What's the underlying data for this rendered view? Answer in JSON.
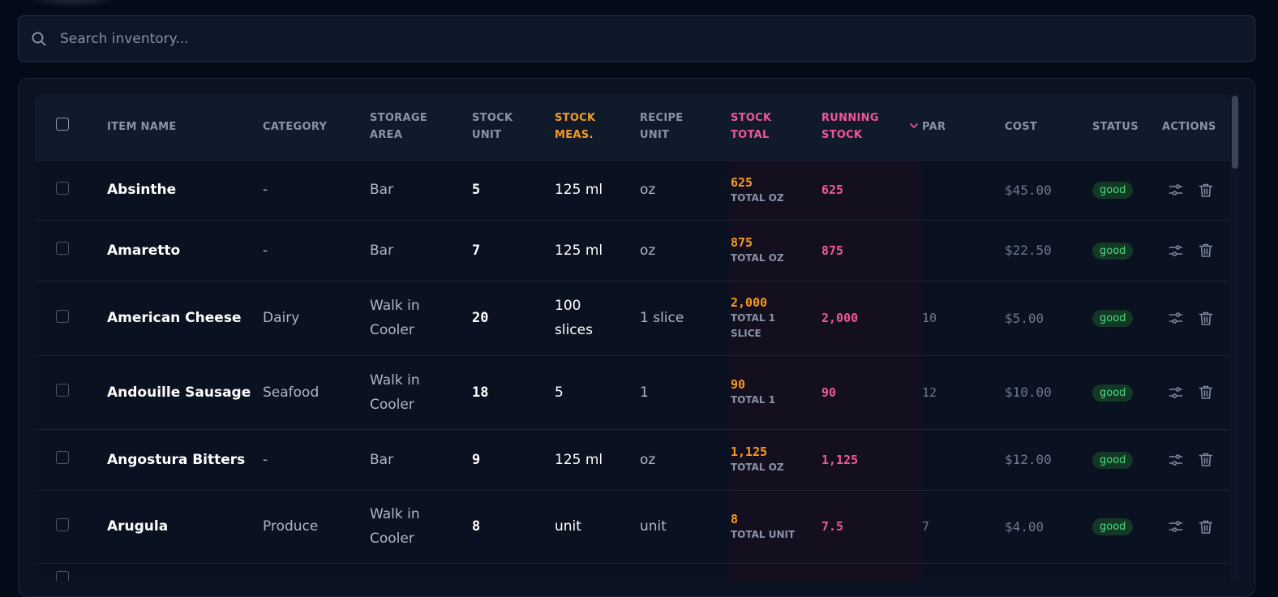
{
  "search": {
    "placeholder": "Search inventory..."
  },
  "table": {
    "headers": {
      "item_name": "ITEM NAME",
      "category": "CATEGORY",
      "storage_area": [
        "STORAGE",
        "AREA"
      ],
      "stock_unit": [
        "STOCK",
        "UNIT"
      ],
      "stock_meas": [
        "STOCK",
        "MEAS."
      ],
      "recipe_unit": [
        "RECIPE",
        "UNIT"
      ],
      "stock_total": [
        "STOCK",
        "TOTAL"
      ],
      "running_stock": [
        "RUNNING",
        "STOCK"
      ],
      "par": "PAR",
      "cost": "COST",
      "status": "STATUS",
      "actions": "ACTIONS"
    },
    "rows": [
      {
        "name": "Absinthe",
        "category": "-",
        "storage": [
          "Bar"
        ],
        "stock_unit": "5",
        "stock_meas": [
          "125 ml"
        ],
        "recipe_unit": "oz",
        "stock_total": "625",
        "total_label": [
          "TOTAL OZ"
        ],
        "running_stock": "625",
        "par": "",
        "cost": "$45.00",
        "status": "good"
      },
      {
        "name": "Amaretto",
        "category": "-",
        "storage": [
          "Bar"
        ],
        "stock_unit": "7",
        "stock_meas": [
          "125 ml"
        ],
        "recipe_unit": "oz",
        "stock_total": "875",
        "total_label": [
          "TOTAL OZ"
        ],
        "running_stock": "875",
        "par": "",
        "cost": "$22.50",
        "status": "good"
      },
      {
        "name": "American Cheese",
        "category": "Dairy",
        "storage": [
          "Walk in",
          "Cooler"
        ],
        "stock_unit": "20",
        "stock_meas": [
          "100",
          "slices"
        ],
        "recipe_unit": "1 slice",
        "stock_total": "2,000",
        "total_label": [
          "TOTAL 1",
          "SLICE"
        ],
        "running_stock": "2,000",
        "par": "10",
        "cost": "$5.00",
        "status": "good"
      },
      {
        "name": "Andouille Sausage",
        "category": "Seafood",
        "storage": [
          "Walk in",
          "Cooler"
        ],
        "stock_unit": "18",
        "stock_meas": [
          "5"
        ],
        "recipe_unit": "1",
        "stock_total": "90",
        "total_label": [
          "TOTAL 1"
        ],
        "running_stock": "90",
        "par": "12",
        "cost": "$10.00",
        "status": "good"
      },
      {
        "name": "Angostura Bitters",
        "category": "-",
        "storage": [
          "Bar"
        ],
        "stock_unit": "9",
        "stock_meas": [
          "125 ml"
        ],
        "recipe_unit": "oz",
        "stock_total": "1,125",
        "total_label": [
          "TOTAL OZ"
        ],
        "running_stock": "1,125",
        "par": "",
        "cost": "$12.00",
        "status": "good"
      },
      {
        "name": "Arugula",
        "category": "Produce",
        "storage": [
          "Walk in",
          "Cooler"
        ],
        "stock_unit": "8",
        "stock_meas": [
          "unit"
        ],
        "recipe_unit": "unit",
        "stock_total": "8",
        "total_label": [
          "TOTAL UNIT"
        ],
        "running_stock": "7.5",
        "par": "7",
        "cost": "$4.00",
        "status": "good"
      },
      {
        "name": "",
        "category": "",
        "storage": [
          ""
        ],
        "stock_unit": "",
        "stock_meas": [
          ""
        ],
        "recipe_unit": "",
        "stock_total": "",
        "total_label": [
          ""
        ],
        "running_stock": "",
        "par": "",
        "cost": "",
        "status": ""
      }
    ]
  },
  "icons": {
    "search": "search-icon",
    "sort": "chevron-down-icon",
    "adjust": "sliders-icon",
    "delete": "trash-icon"
  },
  "colors": {
    "accent_orange": "#f59a23",
    "accent_pink": "#f0569a",
    "status_good_text": "#4ade80",
    "status_good_bg": "#143826",
    "background": "#050a18"
  }
}
